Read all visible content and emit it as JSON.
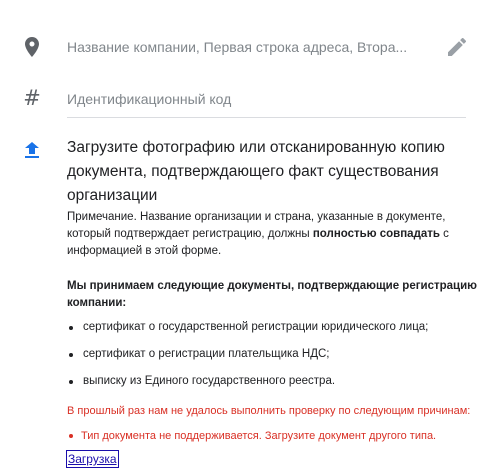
{
  "address_field": {
    "text": "Название компании, Первая строка адреса, Втора...",
    "icon": "location-pin-icon",
    "edit_icon": "pencil-icon"
  },
  "id_field": {
    "placeholder": "Идентификационный код",
    "icon": "hash-icon"
  },
  "upload_section": {
    "icon": "upload-icon",
    "title": "Загрузите фотографию или отсканированную копию документа, подтверждающего факт существования организации",
    "note_prefix": "Примечание. Название организации и страна, указанные в документе, который подтверждает регистрацию, должны ",
    "note_bold": "полностью совпадать",
    "note_suffix": " с информацией в этой форме.",
    "docs_title": "Мы принимаем следующие документы, подтверждающие регистрацию компании:",
    "docs": [
      "сертификат о государственной регистрации юридического лица;",
      "сертификат о регистрации плательщика НДС;",
      "выписку из Единого государственного реестра."
    ],
    "error_title": "В прошлый раз нам не удалось выполнить проверку по следующим причинам:",
    "errors": [
      "Тип документа не поддерживается. Загрузите документ другого типа."
    ],
    "upload_link": "Загрузка"
  },
  "colors": {
    "icon_gray": "#5f6368",
    "upload_blue": "#1a73e8",
    "error_red": "#d93025",
    "link": "#1a0dab"
  }
}
